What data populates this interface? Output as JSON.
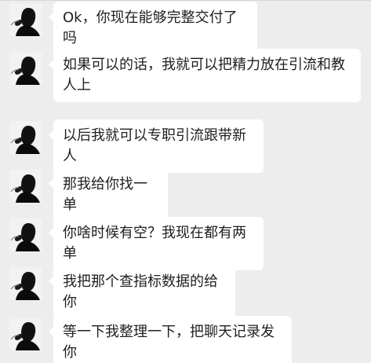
{
  "chat": {
    "messages": [
      {
        "text": "Ok，你现在能够完整交付了吗"
      },
      {
        "text": "如果可以的话，我就可以把精力放在引流和教人上"
      },
      {
        "text": "以后我就可以专职引流跟带新人"
      },
      {
        "text": "那我给你找一单"
      },
      {
        "text": "你啥时候有空？我现在都有两单"
      },
      {
        "text": "我把那个查指标数据的给你"
      },
      {
        "text": "等一下我整理一下，把聊天记录发你"
      }
    ]
  },
  "colors": {
    "background": "#ededed",
    "bubble": "#ffffff",
    "text": "#1f1f1f"
  }
}
